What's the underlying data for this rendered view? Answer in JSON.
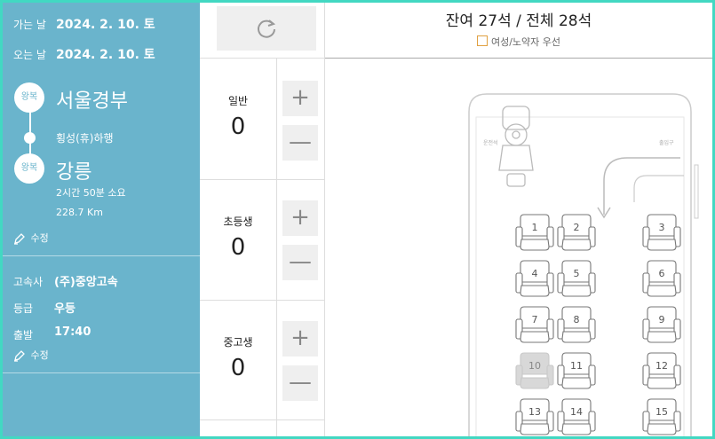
{
  "sidebar": {
    "depart_label": "가는 날",
    "depart_date": "2024. 2. 10. 토",
    "return_label": "오는 날",
    "return_date": "2024. 2. 10. 토",
    "route": {
      "origin_badge": "왕복",
      "origin": "서울경부",
      "via": "횡성(휴)하행",
      "dest_badge": "왕복",
      "destination": "강릉",
      "duration": "2시간 50분 소요",
      "distance": "228.7 Km",
      "edit_label": "수정"
    },
    "info": {
      "company_label": "고속사",
      "company": "(주)중앙고속",
      "grade_label": "등급",
      "grade": "우등",
      "depart_time_label": "출발",
      "depart_time": "17:40",
      "edit_label": "수정"
    }
  },
  "passengers": [
    {
      "label": "일반",
      "count": "0"
    },
    {
      "label": "초등생",
      "count": "0"
    },
    {
      "label": "중고생",
      "count": "0"
    }
  ],
  "buttons": {
    "plus": "+",
    "minus": "—"
  },
  "seat_panel": {
    "remaining": "잔여 27석 / 전체 28석",
    "legend": "여성/노약자 우선",
    "driver_side_label": "운전석",
    "door_label": "출입구"
  },
  "seats": [
    {
      "number": "1",
      "status": "available"
    },
    {
      "number": "2",
      "status": "available"
    },
    {
      "number": "3",
      "status": "available"
    },
    {
      "number": "4",
      "status": "available"
    },
    {
      "number": "5",
      "status": "available"
    },
    {
      "number": "6",
      "status": "available"
    },
    {
      "number": "7",
      "status": "available"
    },
    {
      "number": "8",
      "status": "available"
    },
    {
      "number": "9",
      "status": "available"
    },
    {
      "number": "10",
      "status": "reserved"
    },
    {
      "number": "11",
      "status": "available"
    },
    {
      "number": "12",
      "status": "available"
    },
    {
      "number": "13",
      "status": "available"
    },
    {
      "number": "14",
      "status": "available"
    },
    {
      "number": "15",
      "status": "available"
    }
  ],
  "colors": {
    "sidebar": "#6ab4cc",
    "frame": "#42d8c2",
    "legend_box": "#e0a040",
    "reserved_seat": "#d8d8d8"
  }
}
